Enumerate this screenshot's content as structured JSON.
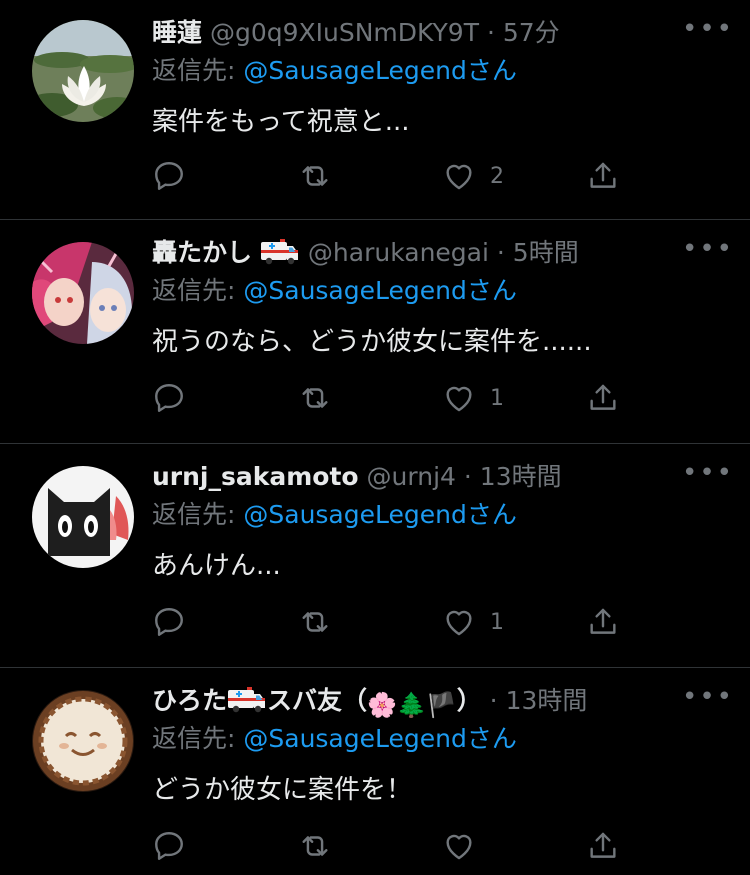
{
  "colors": {
    "background": "#000000",
    "text": "#e7e9ea",
    "muted": "#71767b",
    "link": "#1d9bf0",
    "divider": "#2f3336"
  },
  "tweets": [
    {
      "name": "睡蓮",
      "handle": "@g0q9XIuSNmDKY9T",
      "dot": "·",
      "time": "57分",
      "reply_prefix": "返信先: ",
      "reply_mention": "@SausageLegend",
      "reply_suffix": "さん",
      "text": "案件をもって祝意と...",
      "like_count": "2",
      "avatar_icon": "lotus-avatar"
    },
    {
      "name": "轟たかし",
      "handle": "@harukanegai",
      "dot": "·",
      "time": "5時間",
      "reply_prefix": "返信先: ",
      "reply_mention": "@SausageLegend",
      "reply_suffix": "さん",
      "text": "祝うのなら、どうか彼女に案件を......",
      "like_count": "1",
      "avatar_icon": "anime-avatar"
    },
    {
      "name": "urnj_sakamoto",
      "handle": "@urnj4",
      "dot": "·",
      "time": "13時間",
      "reply_prefix": "返信先: ",
      "reply_mention": "@SausageLegend",
      "reply_suffix": "さん",
      "text": "あんけん...",
      "like_count": "1",
      "avatar_icon": "black-cat-avatar"
    },
    {
      "name": "ひろた",
      "name_mid": "スバ友（",
      "name_end": "）",
      "handle": "",
      "dot": "·",
      "time": "13時間",
      "reply_prefix": "返信先: ",
      "reply_mention": "@SausageLegend",
      "reply_suffix": "さん",
      "text": "どうか彼女に案件を！",
      "like_count": "",
      "avatar_icon": "latte-art-avatar"
    }
  ],
  "icons": [
    "reply-icon",
    "retweet-icon",
    "like-icon",
    "share-icon",
    "more-icon",
    "ambulance-icon",
    "blossom-icon",
    "tree-icon",
    "pirate-flag-icon"
  ]
}
